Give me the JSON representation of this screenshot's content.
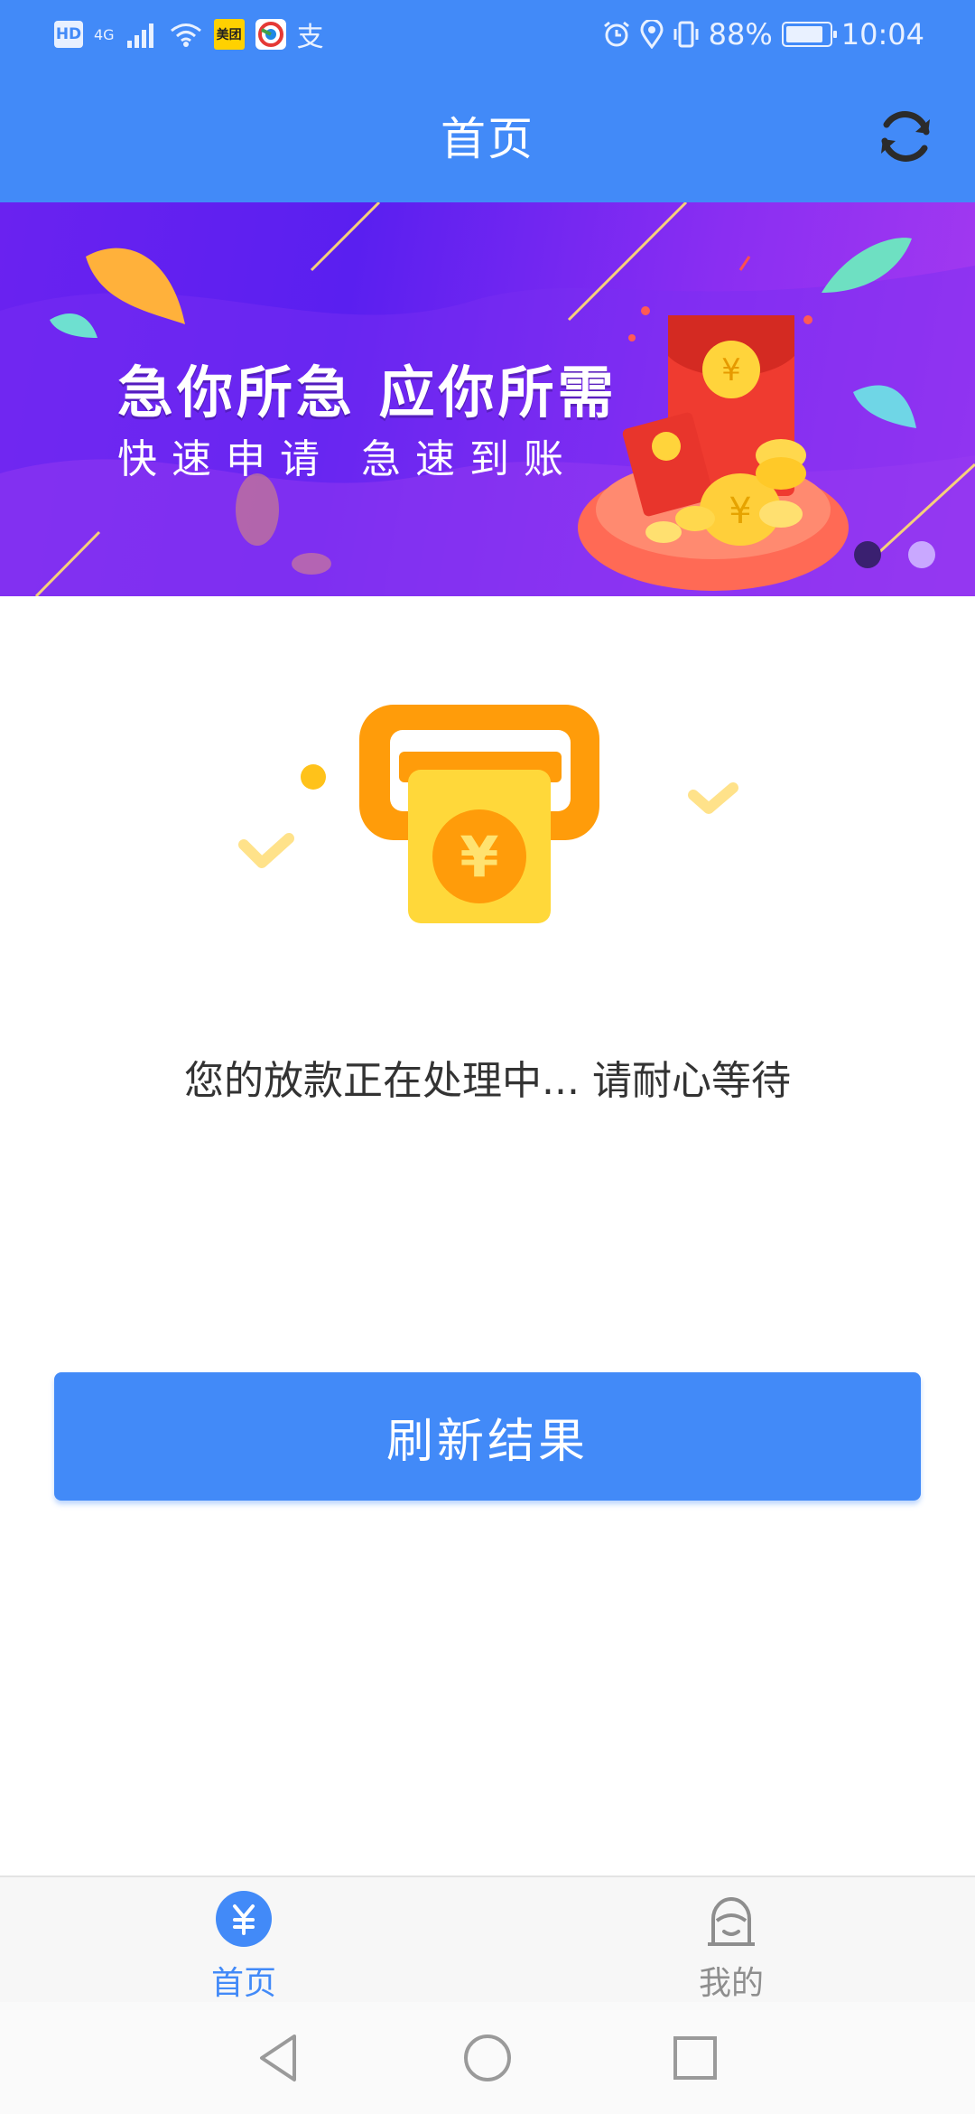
{
  "status_bar": {
    "hd": "HD",
    "net": "4G",
    "meituan": "美团",
    "alipay": "支",
    "battery": "88%",
    "battery_level": 0.88,
    "time": "10:04"
  },
  "header": {
    "title": "首页",
    "refresh_icon": "refresh-icon"
  },
  "banner": {
    "headline": "急你所急 应你所需",
    "subline": "快速申请 急速到账",
    "slide_count": 2,
    "active_slide": 1
  },
  "main": {
    "status_message": "您的放款正在处理中... 请耐心等待",
    "refresh_button": "刷新结果"
  },
  "tabbar": {
    "items": [
      {
        "label": "首页",
        "icon": "yen-coin-icon",
        "active": true
      },
      {
        "label": "我的",
        "icon": "user-icon",
        "active": false
      }
    ]
  },
  "colors": {
    "primary": "#428AF8",
    "tab_inactive": "#8e8e8e",
    "text": "#333333"
  }
}
